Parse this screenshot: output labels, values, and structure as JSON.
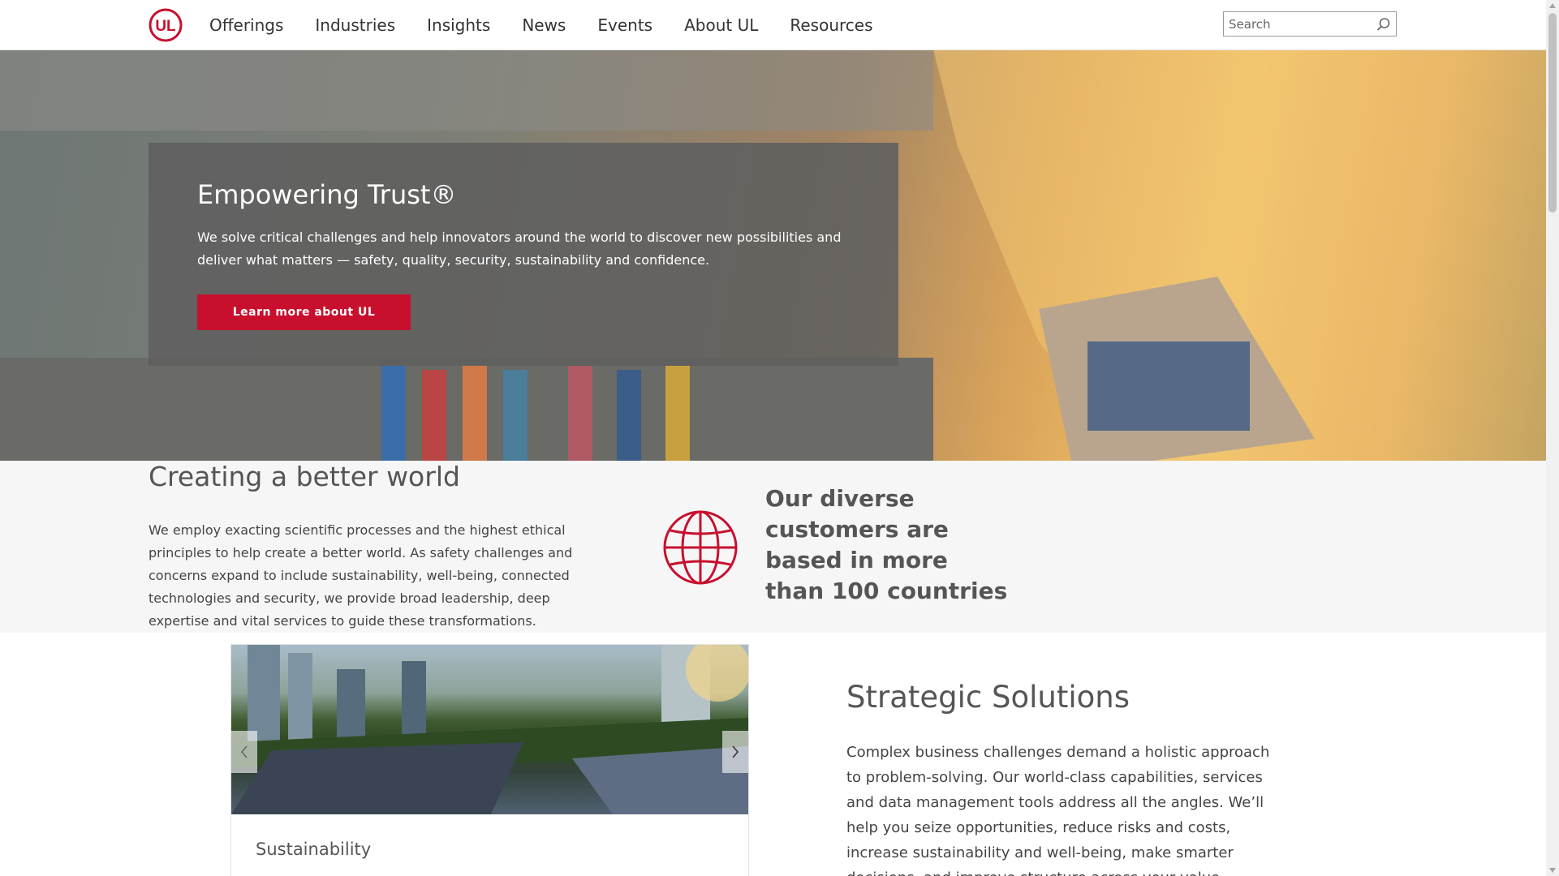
{
  "header": {
    "nav": [
      "Offerings",
      "Industries",
      "Insights",
      "News",
      "Events",
      "About UL",
      "Resources"
    ],
    "search": {
      "placeholder": "Search"
    },
    "logo_text": "UL"
  },
  "hero": {
    "title": "Empowering Trust®",
    "text": "We solve critical challenges and help innovators around the world to discover new possibilities and deliver what matters — safety, quality, security, sustainability and confidence.",
    "button": "Learn more about UL"
  },
  "world": {
    "title": "Creating a better world",
    "text": "We employ exacting scientific processes and the highest ethical principles to help create a better world. As safety challenges and concerns expand to include sustainability, well-being, connected technologies and security, we provide broad leadership, deep expertise and vital services to guide these transformations.",
    "stat": "Our diverse customers are based in more than 100 countries"
  },
  "strategic": {
    "carousel_caption": "Sustainability",
    "title": "Strategic Solutions",
    "text": "Complex business challenges demand a holistic approach to problem-solving. Our world-class capabilities, services and data management tools address all the angles. We’ll help you seize opportunities, reduce risks and costs, increase sustainability and well-being, make smarter decisions, and improve structure across your value network."
  },
  "colors": {
    "brand_red": "#c8102e",
    "panel_gray": "#5f5f5f",
    "section_bg": "#f6f6f6"
  },
  "icons": [
    "ul-logo-icon",
    "search-icon",
    "globe-icon",
    "chevron-left-icon",
    "chevron-right-icon"
  ]
}
